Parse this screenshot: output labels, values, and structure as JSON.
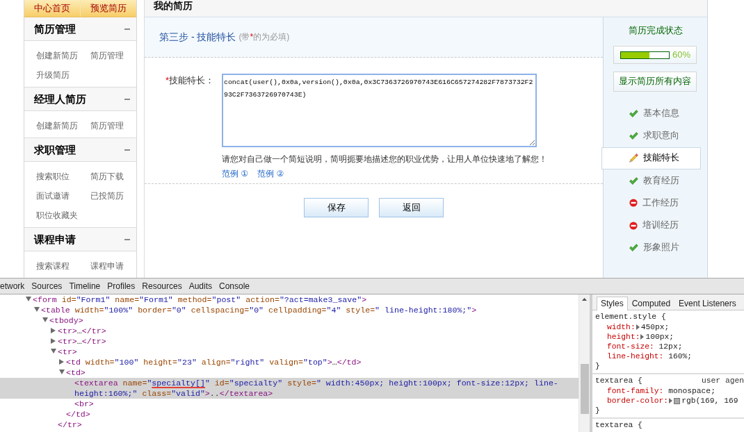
{
  "sidebar": {
    "top_links": [
      "中心首页",
      "预览简历"
    ],
    "sections": [
      {
        "title": "简历管理",
        "expanded": true,
        "links": [
          "创建新简历",
          "简历管理",
          "升级简历"
        ]
      },
      {
        "title": "经理人简历",
        "expanded": true,
        "links": [
          "创建新简历",
          "简历管理"
        ]
      },
      {
        "title": "求职管理",
        "expanded": true,
        "links": [
          "搜索职位",
          "简历下载",
          "面试邀请",
          "已投简历",
          "职位收藏夹"
        ]
      },
      {
        "title": "课程申请",
        "expanded": true,
        "links": [
          "搜索课程",
          "课程申请"
        ]
      }
    ]
  },
  "resume": {
    "title": "我的简历",
    "step_title": "第三步 - 技能特长",
    "required_note": [
      {
        "kind": "plain",
        "text": "(带"
      },
      {
        "kind": "required",
        "text": "*"
      },
      {
        "kind": "plain",
        "text": "的为必填)"
      }
    ],
    "field": {
      "required_mark": "*",
      "label": "技能特长：",
      "value": "concat(user(),0x0a,version(),0x0a,0x3C7363726970743E616C657274282F7873732F293C2F7363726970743E)",
      "focused": true,
      "hint": "请您对自己做一个简短说明，简明扼要地描述您的职业优势，让用人单位快速地了解您！",
      "examples": [
        "范例 ①",
        "范例 ②"
      ]
    },
    "buttons": [
      "保存",
      "返回"
    ]
  },
  "status_panel": {
    "title": "简历完成状态",
    "progress": {
      "level": 0.6,
      "reading": "60%"
    },
    "show_all_button": "显示简历所有内容",
    "steps": [
      {
        "label": "基本信息",
        "kind": "done",
        "selected": false
      },
      {
        "label": "求职意向",
        "kind": "done",
        "selected": false
      },
      {
        "label": "技能特长",
        "kind": "editing",
        "selected": true
      },
      {
        "label": "教育经历",
        "kind": "done",
        "selected": false
      },
      {
        "label": "工作经历",
        "kind": "missing",
        "selected": false
      },
      {
        "label": "培训经历",
        "kind": "missing",
        "selected": false
      },
      {
        "label": "形象照片",
        "kind": "done",
        "selected": false
      }
    ]
  },
  "devtools": {
    "panel_tabs": [
      "etwork",
      "Sources",
      "Timeline",
      "Profiles",
      "Resources",
      "Audits",
      "Console"
    ],
    "dom_tree": [
      {
        "expanded": true,
        "selected": false,
        "parts": [
          {
            "kind": "tag",
            "text": "<form"
          },
          {
            "kind": "attr",
            "text": " id="
          },
          {
            "kind": "value",
            "text": "\"Form1\""
          },
          {
            "kind": "attr",
            "text": " name="
          },
          {
            "kind": "value",
            "text": "\"Form1\""
          },
          {
            "kind": "attr",
            "text": " method="
          },
          {
            "kind": "value",
            "text": "\"post\""
          },
          {
            "kind": "attr",
            "text": " action="
          },
          {
            "kind": "value",
            "text": "\"?act=make3_save\""
          },
          {
            "kind": "tag",
            "text": ">"
          }
        ],
        "children": [
          {
            "expanded": true,
            "selected": false,
            "parts": [
              {
                "kind": "tag",
                "text": "<table"
              },
              {
                "kind": "attr",
                "text": " width="
              },
              {
                "kind": "value",
                "text": "\"100%\""
              },
              {
                "kind": "attr",
                "text": " border="
              },
              {
                "kind": "value",
                "text": "\"0\""
              },
              {
                "kind": "attr",
                "text": " cellspacing="
              },
              {
                "kind": "value",
                "text": "\"0\""
              },
              {
                "kind": "attr",
                "text": " cellpadding="
              },
              {
                "kind": "value",
                "text": "\"4\""
              },
              {
                "kind": "attr",
                "text": " style="
              },
              {
                "kind": "value",
                "text": "\" line-height:180%;\""
              },
              {
                "kind": "tag",
                "text": ">"
              }
            ],
            "children": [
              {
                "expanded": true,
                "selected": false,
                "parts": [
                  {
                    "kind": "tag",
                    "text": "<tbody>"
                  }
                ],
                "children": [
                  {
                    "expanded": false,
                    "selected": false,
                    "parts": [
                      {
                        "kind": "tag",
                        "text": "<tr>"
                      },
                      {
                        "kind": "text",
                        "text": "…"
                      },
                      {
                        "kind": "tag",
                        "text": "</tr>"
                      }
                    ]
                  },
                  {
                    "expanded": false,
                    "selected": false,
                    "parts": [
                      {
                        "kind": "tag",
                        "text": "<tr>"
                      },
                      {
                        "kind": "text",
                        "text": "…"
                      },
                      {
                        "kind": "tag",
                        "text": "</tr>"
                      }
                    ]
                  },
                  {
                    "expanded": true,
                    "selected": false,
                    "parts": [
                      {
                        "kind": "tag",
                        "text": "<tr>"
                      }
                    ],
                    "children": [
                      {
                        "expanded": false,
                        "selected": false,
                        "parts": [
                          {
                            "kind": "tag",
                            "text": "<td"
                          },
                          {
                            "kind": "attr",
                            "text": " width="
                          },
                          {
                            "kind": "value",
                            "text": "\"100\""
                          },
                          {
                            "kind": "attr",
                            "text": " height="
                          },
                          {
                            "kind": "value",
                            "text": "\"23\""
                          },
                          {
                            "kind": "attr",
                            "text": " align="
                          },
                          {
                            "kind": "value",
                            "text": "\"right\""
                          },
                          {
                            "kind": "attr",
                            "text": " valign="
                          },
                          {
                            "kind": "value",
                            "text": "\"top\""
                          },
                          {
                            "kind": "tag",
                            "text": ">"
                          },
                          {
                            "kind": "text",
                            "text": "…"
                          },
                          {
                            "kind": "tag",
                            "text": "</td>"
                          }
                        ]
                      },
                      {
                        "expanded": true,
                        "selected": false,
                        "parts": [
                          {
                            "kind": "tag",
                            "text": "<td>"
                          }
                        ],
                        "children": [
                          {
                            "selected": true,
                            "parts": [
                              {
                                "kind": "tag",
                                "text": "<textarea"
                              },
                              {
                                "kind": "attr",
                                "text": " name="
                              },
                              {
                                "kind": "value",
                                "text": "\""
                              },
                              {
                                "kind": "value",
                                "text": "specialty[]",
                                "underlined": true
                              },
                              {
                                "kind": "value",
                                "text": "\""
                              },
                              {
                                "kind": "attr",
                                "text": " id="
                              },
                              {
                                "kind": "value",
                                "text": "\"specialty\""
                              },
                              {
                                "kind": "attr",
                                "text": " style="
                              },
                              {
                                "kind": "value",
                                "text": "\" width:450px; height:100px; font-size:12px; line-height:160%;\""
                              },
                              {
                                "kind": "attr",
                                "text": " class="
                              },
                              {
                                "kind": "value",
                                "text": "\"valid\""
                              },
                              {
                                "kind": "tag",
                                "text": ">"
                              },
                              {
                                "kind": "text",
                                "text": ".."
                              },
                              {
                                "kind": "tag",
                                "text": "</textarea>"
                              }
                            ]
                          },
                          {
                            "selected": false,
                            "parts": [
                              {
                                "kind": "tag",
                                "text": "<br>"
                              }
                            ]
                          }
                        ],
                        "closing": [
                          {
                            "kind": "tag",
                            "text": "</td>"
                          }
                        ]
                      }
                    ],
                    "closing": [
                      {
                        "kind": "tag",
                        "text": "</tr>"
                      }
                    ]
                  }
                ]
              }
            ]
          }
        ]
      }
    ],
    "sidebar_tabs": [
      {
        "label": "Styles",
        "selected": true
      },
      {
        "label": "Computed",
        "selected": false
      },
      {
        "label": "Event Listeners",
        "selected": false
      }
    ],
    "style_rules": [
      {
        "selector": "element.style {",
        "properties": [
          {
            "name": "width:",
            "value": "450px;",
            "expandable": true
          },
          {
            "name": "height:",
            "value": "100px;",
            "expandable": true
          },
          {
            "name": "font-size:",
            "value": "12px;",
            "expandable": false
          },
          {
            "name": "line-height:",
            "value": "160%;",
            "expandable": false
          }
        ],
        "closing": "}"
      },
      {
        "selector": "textarea {",
        "origin": "user agen",
        "properties": [
          {
            "name": "font-family:",
            "value": "monospace;",
            "expandable": false
          },
          {
            "name": "border-color:",
            "value": "rgb(169, 169",
            "expandable": true,
            "color": "#a9a9a9"
          }
        ],
        "closing": "}"
      },
      {
        "selector": "textarea {"
      }
    ]
  }
}
